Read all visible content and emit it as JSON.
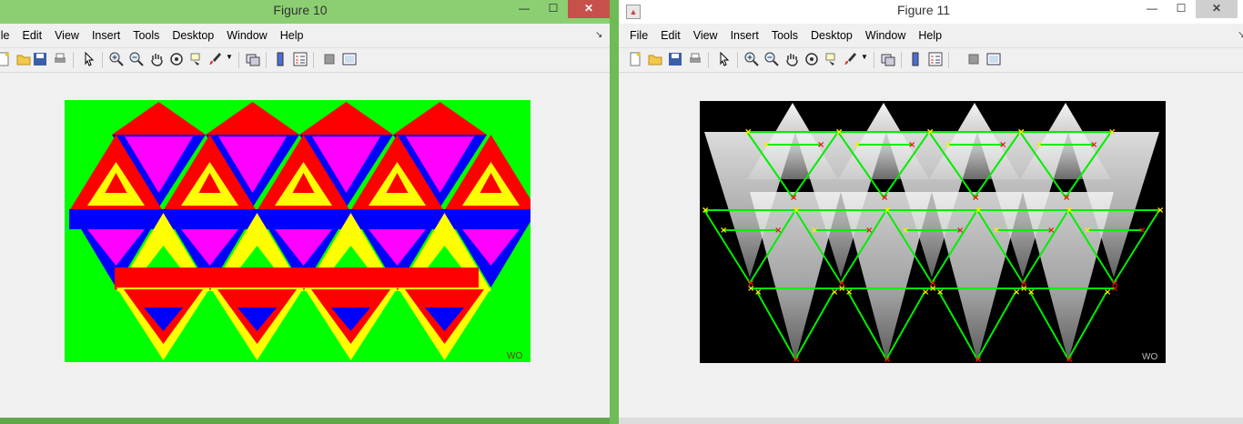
{
  "windows": [
    {
      "title": "Figure 10",
      "menu": [
        "ile",
        "Edit",
        "View",
        "Insert",
        "Tools",
        "Desktop",
        "Window",
        "Help"
      ],
      "watermark": "WO"
    },
    {
      "title": "Figure 11",
      "menu": [
        "File",
        "Edit",
        "View",
        "Insert",
        "Tools",
        "Desktop",
        "Window",
        "Help"
      ],
      "watermark": "WO"
    }
  ],
  "icons": [
    "new-figure-icon",
    "open-file-icon",
    "save-icon",
    "print-icon",
    "pointer-icon",
    "zoom-in-icon",
    "zoom-out-icon",
    "pan-icon",
    "rotate-3d-icon",
    "data-cursor-icon",
    "brush-icon",
    "link-plot-icon",
    "colorbar-icon",
    "legend-icon",
    "hide-plot-tools-icon",
    "show-plot-tools-icon"
  ],
  "colors": {
    "green": "#00ff00",
    "blue": "#0000ff",
    "red": "#ff0000",
    "yellow": "#ffff00",
    "magenta": "#ff00ff",
    "black": "#000000"
  }
}
